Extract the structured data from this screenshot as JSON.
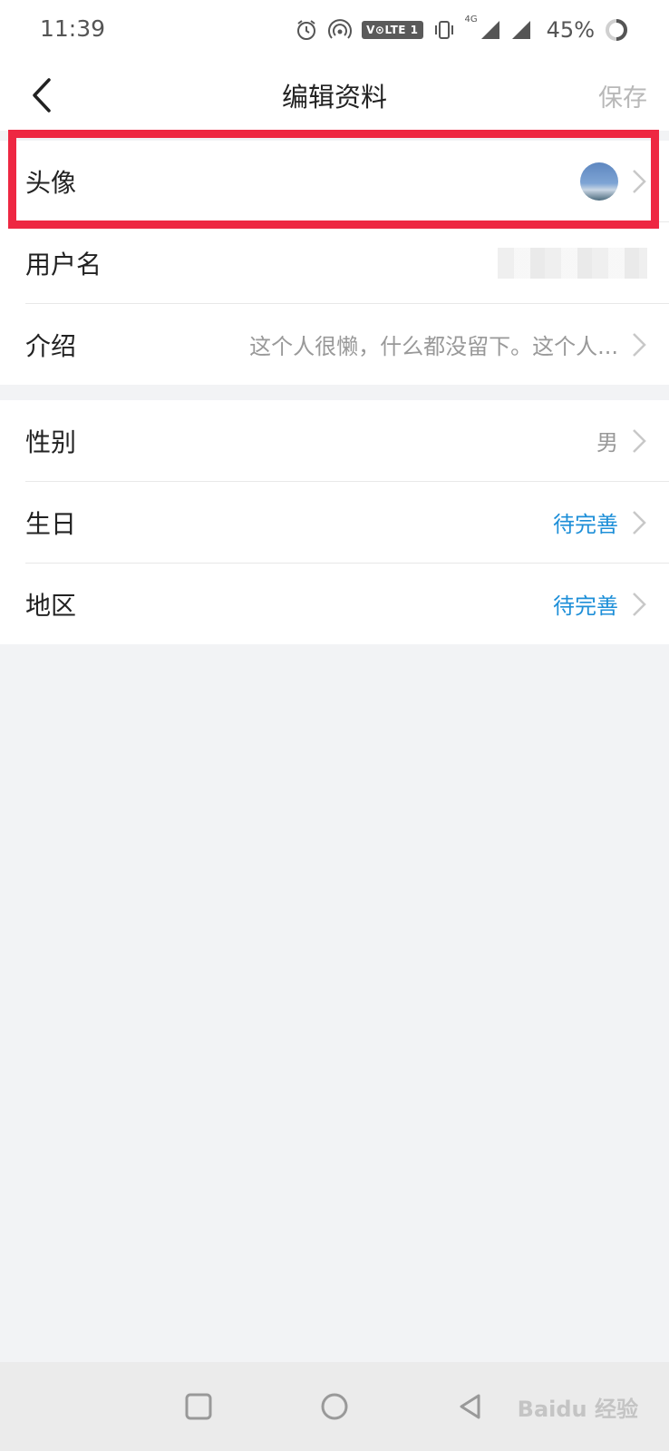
{
  "status_bar": {
    "time": "11:39",
    "network_badge": "V⊙LTE 1",
    "network_type": "4G",
    "battery_percent": "45%",
    "icons": [
      "alarm-icon",
      "hotspot-icon",
      "volte-icon",
      "vibrate-icon",
      "signal-icon",
      "signal-icon",
      "battery-icon"
    ]
  },
  "header": {
    "title": "编辑资料",
    "save_label": "保存",
    "back_icon": "chevron-left-icon"
  },
  "profile": {
    "avatar": {
      "label": "头像"
    },
    "username": {
      "label": "用户名"
    },
    "intro": {
      "label": "介绍",
      "value": "这个人很懒，什么都没留下。这个人..."
    }
  },
  "details": {
    "gender": {
      "label": "性别",
      "value": "男"
    },
    "birthday": {
      "label": "生日",
      "value": "待完善"
    },
    "region": {
      "label": "地区",
      "value": "待完善"
    }
  },
  "nav_bar": {
    "icons": [
      "recents-square-icon",
      "home-circle-icon",
      "back-triangle-icon"
    ],
    "watermark": "Baidu 经验"
  },
  "colors": {
    "accent": "#1e8fd8",
    "highlight": "#ee2742",
    "background": "#f2f3f5"
  }
}
